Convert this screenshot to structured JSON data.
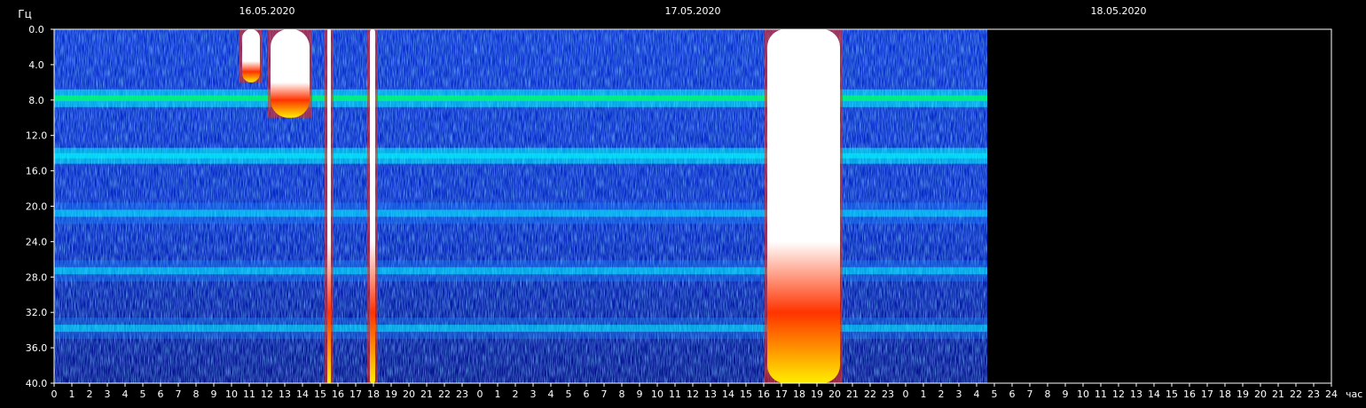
{
  "chart_data": {
    "type": "heatmap",
    "title": "",
    "ylabel": "Гц",
    "xlabel": "час",
    "ylim": [
      0,
      40
    ],
    "y_ticks": [
      "0.0",
      "4.0",
      "8.0",
      "12.0",
      "16.0",
      "20.0",
      "24.0",
      "28.0",
      "32.0",
      "36.0",
      "40.0"
    ],
    "dates": [
      "16.05.2020",
      "17.05.2020",
      "18.05.2020"
    ],
    "hour_ticks": [
      "0",
      "1",
      "2",
      "3",
      "4",
      "5",
      "6",
      "7",
      "8",
      "9",
      "10",
      "11",
      "12",
      "13",
      "14",
      "15",
      "16",
      "17",
      "18",
      "19",
      "20",
      "21",
      "22",
      "23",
      "0",
      "1",
      "2",
      "3",
      "4",
      "5",
      "6",
      "7",
      "8",
      "9",
      "10",
      "11",
      "12",
      "13",
      "14",
      "15",
      "16",
      "17",
      "18",
      "19",
      "20",
      "21",
      "22",
      "23",
      "0",
      "1",
      "2",
      "3",
      "4",
      "5",
      "6",
      "7",
      "8",
      "9",
      "10",
      "11",
      "12",
      "13",
      "14",
      "15",
      "16",
      "17",
      "18",
      "19",
      "20",
      "21",
      "22",
      "23",
      "24"
    ],
    "data_end_hours": 52.6,
    "resonance_bands_hz": [
      7.8,
      14.3,
      20.8,
      27.3,
      33.8
    ],
    "bursts": [
      {
        "start_hours": 10.6,
        "end_hours": 11.6,
        "to_hz": 6.0
      },
      {
        "start_hours": 12.2,
        "end_hours": 14.4,
        "to_hz": 10.0
      },
      {
        "start_hours": 15.4,
        "end_hours": 15.6,
        "to_hz": 40.0
      },
      {
        "start_hours": 17.8,
        "end_hours": 18.1,
        "to_hz": 40.0
      },
      {
        "start_hours": 40.2,
        "end_hours": 44.3,
        "to_hz": 40.0
      }
    ],
    "colors": [
      "#0000a8",
      "#0044ff",
      "#00ffff",
      "#00ff66",
      "#ffff00",
      "#ff2200",
      "#ffffff"
    ]
  }
}
